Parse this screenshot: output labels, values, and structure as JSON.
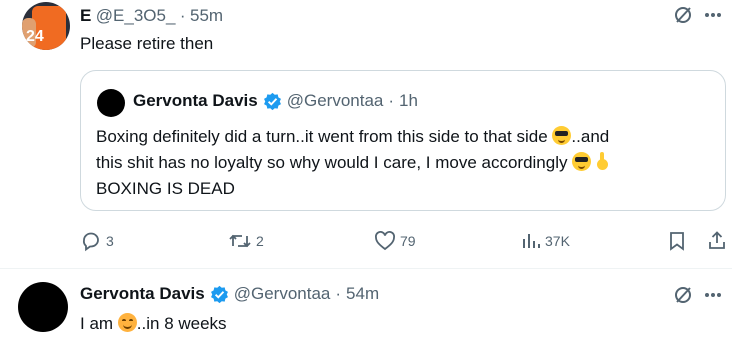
{
  "tweet1": {
    "name": "E",
    "handle": "@E_3O5_",
    "sep": "·",
    "time": "55m",
    "text": "Please retire then",
    "avatar_number": "24"
  },
  "quote": {
    "name": "Gervonta Davis",
    "handle": "@Gervontaa",
    "sep": "·",
    "time": "1h",
    "line1": "Boxing definitely did a turn..it went from this side to that side",
    "line1_end": "..and",
    "line2": "this shit has no loyalty so why would I care, I move accordingly",
    "line3": "BOXING IS DEAD"
  },
  "actions": {
    "replies": "3",
    "reposts": "2",
    "likes": "79",
    "views": "37K"
  },
  "tweet2": {
    "name": "Gervonta Davis",
    "handle": "@Gervontaa",
    "sep": "·",
    "time": "54m",
    "text_before": "I am",
    "text_after": "..in 8 weeks"
  },
  "colors": {
    "verified": "#1d9bf0",
    "muted": "#536471",
    "border": "#cfd9de",
    "text": "#0f1419"
  },
  "icons": [
    "grok-icon",
    "more-icon",
    "verified-badge-icon",
    "reply-icon",
    "repost-icon",
    "like-icon",
    "views-icon",
    "bookmark-icon",
    "share-icon"
  ]
}
